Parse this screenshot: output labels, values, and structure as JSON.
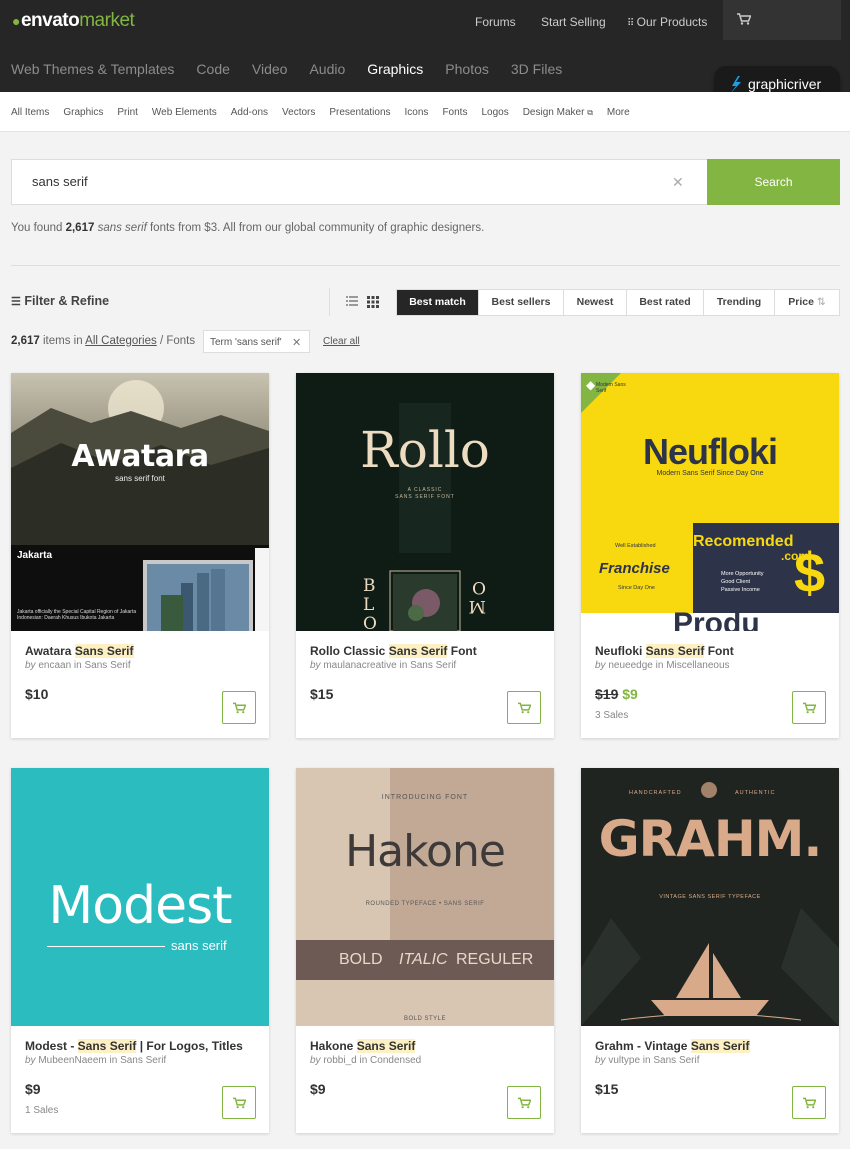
{
  "header": {
    "logo_brand": "envato",
    "logo_suffix": "market",
    "nav": {
      "forums": "Forums",
      "start_selling": "Start Selling",
      "our_products": "Our Products"
    },
    "categories": [
      "Web Themes & Templates",
      "Code",
      "Video",
      "Audio",
      "Graphics",
      "Photos",
      "3D Files"
    ],
    "active_category": "Graphics",
    "site_badge": "graphicriver"
  },
  "subnav": [
    "All Items",
    "Graphics",
    "Print",
    "Web Elements",
    "Add-ons",
    "Vectors",
    "Presentations",
    "Icons",
    "Fonts",
    "Logos",
    "Design Maker",
    "More"
  ],
  "search": {
    "value": "sans serif",
    "button": "Search"
  },
  "results": {
    "pre": "You found ",
    "count": "2,617",
    "term": "sans serif",
    "post": " fonts from $3. All from our global community of graphic designers."
  },
  "toolbar": {
    "filter_label": "Filter & Refine",
    "sorts": [
      "Best match",
      "Best sellers",
      "Newest",
      "Best rated",
      "Trending",
      "Price"
    ],
    "active_sort": "Best match"
  },
  "breadcrumb": {
    "count": "2,617",
    "items_in": " items in ",
    "category": "All Categories",
    "sub": " / Fonts",
    "term_chip": "Term 'sans serif'",
    "clear_all": "Clear all"
  },
  "products": [
    {
      "title_pre": "Awatara ",
      "title_hl": "Sans Serif",
      "title_post": "",
      "author": "encaan",
      "category": "Sans Serif",
      "price": "$10",
      "old_price": "",
      "sale_price": "",
      "sales": "",
      "art": {
        "name": "Awatara",
        "tag": "sans serif font",
        "city": "Jakarta",
        "desc": "Jakarta officially the Special Capital Region of Jakarta Indonesian: Daerah Khusus Ibukota Jakarta"
      }
    },
    {
      "title_pre": "Rollo Classic ",
      "title_hl": "Sans Serif",
      "title_post": " Font",
      "author": "maulanacreative",
      "category": "Sans Serif",
      "price": "$15",
      "old_price": "",
      "sale_price": "",
      "sales": "",
      "art": {
        "name": "Rollo",
        "tag1": "A CLASSIC",
        "tag2": "SANS SERIF FONT",
        "left": "BLO",
        "right": "MO"
      }
    },
    {
      "title_pre": "Neufloki ",
      "title_hl": "Sans Serif",
      "title_post": " Font",
      "author": "neueedge",
      "category": "Miscellaneous",
      "price": "",
      "old_price": "$19",
      "sale_price": "$9",
      "sales": "3 Sales",
      "art": {
        "corner": "Modern Sans Serif",
        "name": "Neufloki",
        "tag": "Modern Sans Serif Since Day One",
        "est": "Well Established",
        "franchise": "Franchise",
        "since": "Since Day One",
        "rec": "Recomended",
        "com": ".com",
        "opp1": "More Opportunity",
        "opp2": "Good Client",
        "opp3": "Passive Income",
        "dollar": "$",
        "produ": "Produ"
      }
    },
    {
      "title_pre": "Modest - ",
      "title_hl": "Sans Serif",
      "title_post": " | For Logos, Titles",
      "author": "MubeenNaeem",
      "category": "Sans Serif",
      "price": "$9",
      "old_price": "",
      "sale_price": "",
      "sales": "1 Sales",
      "art": {
        "name": "Modest",
        "tag": "sans serif"
      }
    },
    {
      "title_pre": "Hakone ",
      "title_hl": "Sans Serif",
      "title_post": "",
      "author": "robbi_d",
      "category": "Condensed",
      "price": "$9",
      "old_price": "",
      "sale_price": "",
      "sales": "",
      "art": {
        "intro": "INTRODUCING FONT",
        "name": "Hakone",
        "tag": "ROUNDED TYPEFACE • SANS SERIF",
        "w1": "BOLD",
        "w2": "ITALIC",
        "w3": "REGULER",
        "style": "BOLD STYLE"
      }
    },
    {
      "title_pre": "Grahm - Vintage ",
      "title_hl": "Sans Serif",
      "title_post": "",
      "author": "vultype",
      "category": "Sans Serif",
      "price": "$15",
      "old_price": "",
      "sale_price": "",
      "sales": "",
      "art": {
        "hand": "HANDCRAFTED",
        "auth": "AUTHENTIC",
        "name": "GRAHM.",
        "tag": "VINTAGE SANS SERIF TYPEFACE"
      }
    }
  ],
  "labels": {
    "by": "by ",
    "in": " in "
  },
  "colors": {
    "brand_green": "#82b541",
    "header_bg": "#262626",
    "highlight": "#fdf0c3"
  }
}
